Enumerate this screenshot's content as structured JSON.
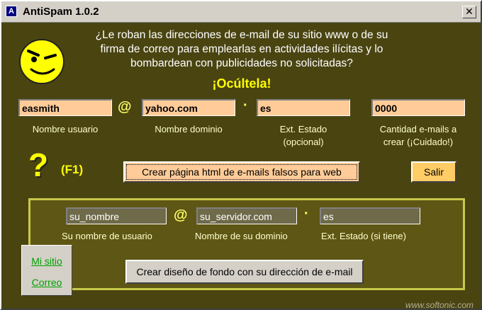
{
  "window": {
    "title": "AntiSpam 1.0.2",
    "close_label": "✕"
  },
  "intro": {
    "line1": "¿Le roban las direcciones de e-mail de su sitio www o de su",
    "line2": "firma de correo para emplearlas en actividades ilícitas y lo",
    "line3": "bombardean con publicidades no solicitadas?",
    "headline": "¡Ocúltela!"
  },
  "fake": {
    "username": "easmith",
    "domain": "yahoo.com",
    "ext": "es",
    "count": "0000",
    "at_sign": "@",
    "dot": "·",
    "labels": {
      "username": "Nombre usuario",
      "domain": "Nombre dominio",
      "ext_line1": "Ext. Estado",
      "ext_line2": "(opcional)",
      "count_line1": "Cantidad e-mails a",
      "count_line2": "crear (¡Cuidado!)"
    }
  },
  "help": {
    "mark": "?",
    "key": "(F1)"
  },
  "buttons": {
    "create_page": "Crear página html de e-mails falsos para web",
    "exit": "Salir",
    "create_bg": "Crear diseño de fondo con su dirección de e-mail"
  },
  "own": {
    "username": "su_nombre",
    "server": "su_servidor.com",
    "ext": "es",
    "at_sign": "@",
    "dot": "·",
    "labels": {
      "username": "Su nombre de usuario",
      "server": "Nombre de su dominio",
      "ext": "Ext. Estado (si tiene)"
    }
  },
  "links": {
    "site": "Mi sitio",
    "mail": "Correo"
  },
  "watermark": "www.softonic.com",
  "colors": {
    "background": "#4a4411",
    "field_fill": "#ffcc99",
    "headline": "#ffff00",
    "panel_border": "#c8c84a"
  },
  "icons": {
    "app": "window-app-icon",
    "face": "winking-smiley-icon"
  }
}
